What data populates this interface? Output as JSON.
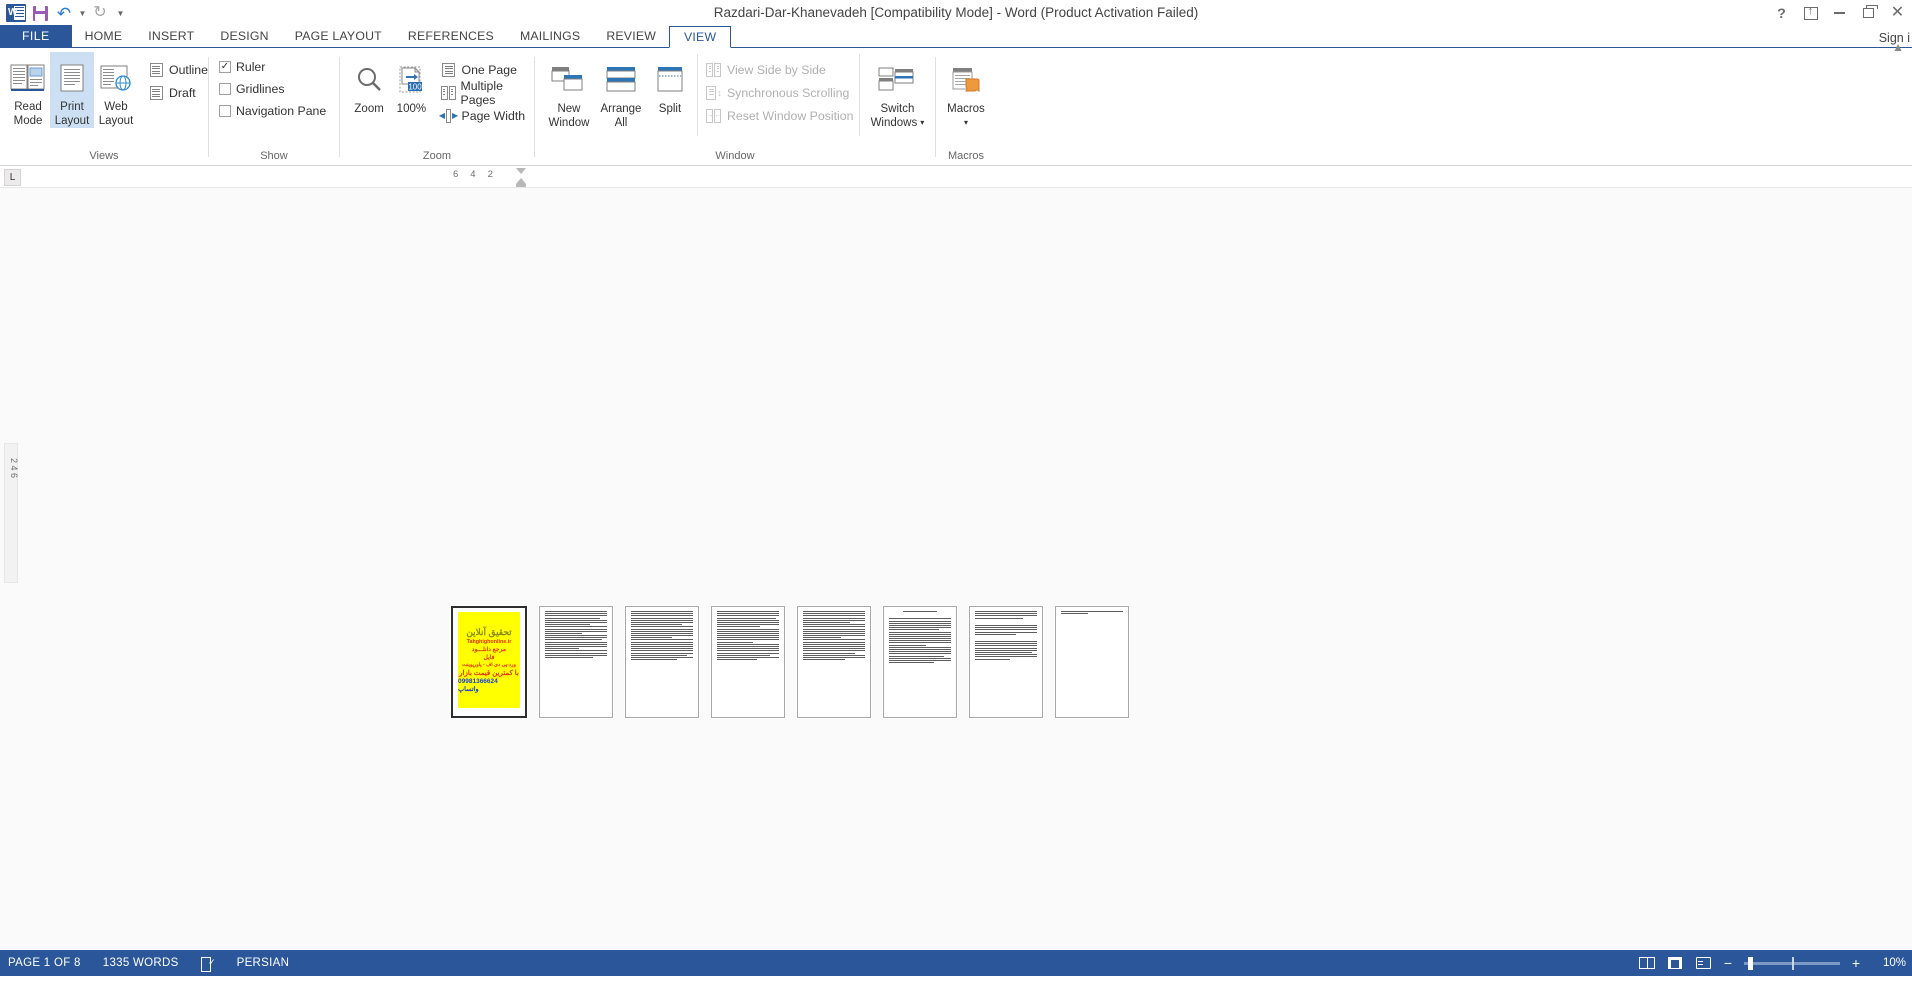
{
  "titlebar": {
    "doc_title": "Razdari-Dar-Khanevadeh [Compatibility Mode] - Word (Product Activation Failed)",
    "qat": [
      {
        "name": "word-logo-icon",
        "label": "W"
      },
      {
        "name": "save-icon",
        "label": "Save"
      },
      {
        "name": "undo-icon",
        "label": "Undo"
      },
      {
        "name": "redo-icon",
        "label": "Redo"
      },
      {
        "name": "customize-qat-icon",
        "label": "Customize Quick Access Toolbar"
      }
    ],
    "window_controls": [
      {
        "name": "help-button",
        "label": "?"
      },
      {
        "name": "ribbon-display-options-button",
        "label": "Ribbon Display Options"
      },
      {
        "name": "minimize-button",
        "label": "Minimize"
      },
      {
        "name": "restore-button",
        "label": "Restore Down"
      },
      {
        "name": "close-button",
        "label": "Close"
      }
    ]
  },
  "tabs": {
    "file": "FILE",
    "items": [
      {
        "label": "HOME",
        "active": false
      },
      {
        "label": "INSERT",
        "active": false
      },
      {
        "label": "DESIGN",
        "active": false
      },
      {
        "label": "PAGE LAYOUT",
        "active": false
      },
      {
        "label": "REFERENCES",
        "active": false
      },
      {
        "label": "MAILINGS",
        "active": false
      },
      {
        "label": "REVIEW",
        "active": false
      },
      {
        "label": "VIEW",
        "active": true
      }
    ],
    "signin": "Sign i"
  },
  "ribbon": {
    "groups": {
      "views": {
        "label": "Views",
        "buttons": [
          {
            "label_line1": "Read",
            "label_line2": "Mode",
            "selected": false
          },
          {
            "label_line1": "Print",
            "label_line2": "Layout",
            "selected": true
          },
          {
            "label_line1": "Web",
            "label_line2": "Layout",
            "selected": false
          }
        ],
        "small_items": [
          {
            "label": "Outline"
          },
          {
            "label": "Draft"
          }
        ]
      },
      "show": {
        "label": "Show",
        "checkboxes": [
          {
            "label": "Ruler",
            "checked": true
          },
          {
            "label": "Gridlines",
            "checked": false
          },
          {
            "label": "Navigation Pane",
            "checked": false
          }
        ]
      },
      "zoom": {
        "label": "Zoom",
        "buttons": [
          {
            "label": "Zoom"
          },
          {
            "label": "100%",
            "badge": "100"
          }
        ],
        "small_items": [
          {
            "label": "One Page"
          },
          {
            "label": "Multiple Pages"
          },
          {
            "label": "Page Width"
          }
        ]
      },
      "window": {
        "label": "Window",
        "buttons": [
          {
            "label_line1": "New",
            "label_line2": "Window"
          },
          {
            "label_line1": "Arrange",
            "label_line2": "All"
          },
          {
            "label_line1": "Split",
            "label_line2": ""
          }
        ],
        "small_items": [
          {
            "label": "View Side by Side",
            "disabled": true
          },
          {
            "label": "Synchronous Scrolling",
            "disabled": true
          },
          {
            "label": "Reset Window Position",
            "disabled": true
          }
        ],
        "switch_windows": {
          "label_line1": "Switch",
          "label_line2": "Windows",
          "caret": "▾"
        }
      },
      "macros": {
        "label": "Macros",
        "button": {
          "label": "Macros",
          "caret": "▾"
        }
      }
    },
    "collapse_icon": "▲"
  },
  "ruler": {
    "tab_selector": "L",
    "numbers": [
      "6",
      "4",
      "2"
    ],
    "vertical_numbers": "2   4   6"
  },
  "document": {
    "ad": {
      "line1": "تحقیق آنلاین",
      "line2": "Tahghighonline.ir",
      "line3": "مرجع دانلـــود",
      "line4": "فایل",
      "line5": "ورد-پی دی اف - پاورپوینت",
      "line6": "با کمترین قیمت بازار",
      "line7": "09981366624 واتساپ"
    },
    "page_count": 8
  },
  "statusbar": {
    "page_indicator": "PAGE 1 OF 8",
    "word_count": "1335 WORDS",
    "proofing_icon": "proofing-errors-icon",
    "language": "PERSIAN",
    "views": [
      {
        "name": "read-mode-view-button"
      },
      {
        "name": "print-layout-view-button"
      },
      {
        "name": "web-layout-view-button"
      }
    ],
    "zoom_out": "−",
    "zoom_in": "+",
    "zoom_level": "10%"
  }
}
